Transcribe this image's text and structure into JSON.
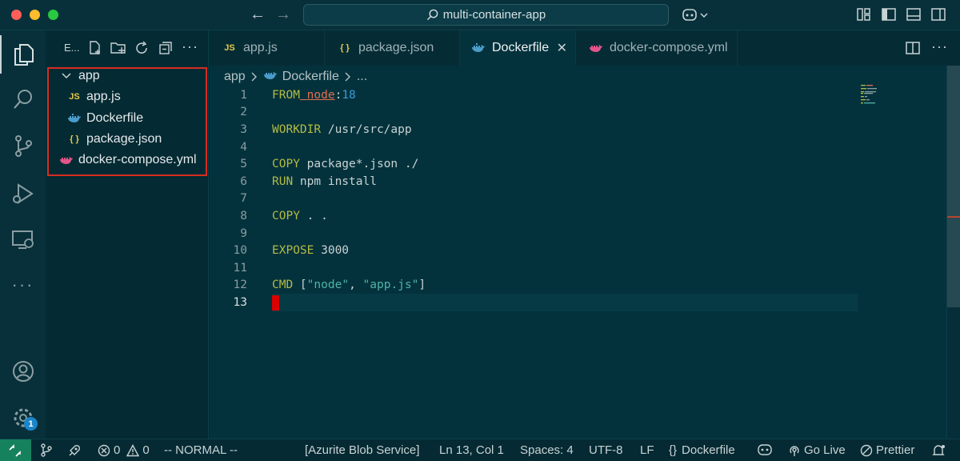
{
  "window": {
    "title": "multi-container-app"
  },
  "sidebar": {
    "title": "E...",
    "tree": [
      {
        "label": "app",
        "type": "folder"
      },
      {
        "label": "app.js",
        "type": "js",
        "icon_text": "JS"
      },
      {
        "label": "Dockerfile",
        "type": "docker"
      },
      {
        "label": "package.json",
        "type": "json",
        "icon_text": "{ }"
      },
      {
        "label": "docker-compose.yml",
        "type": "compose"
      }
    ]
  },
  "tabs": [
    {
      "label": "app.js",
      "icon_text": "JS"
    },
    {
      "label": "package.json",
      "icon_text": "{ }"
    },
    {
      "label": "Dockerfile",
      "active": true
    },
    {
      "label": "docker-compose.yml"
    }
  ],
  "breadcrumb": {
    "folder": "app",
    "file": "Dockerfile",
    "more": "..."
  },
  "editor": {
    "lines": [
      {
        "n": "1",
        "tokens": [
          [
            "kw",
            "FROM"
          ],
          [
            "",
            ""
          ],
          [
            "img",
            "node"
          ],
          [
            "",
            ":"
          ],
          [
            "num",
            "18"
          ]
        ]
      },
      {
        "n": "2",
        "tokens": []
      },
      {
        "n": "3",
        "tokens": [
          [
            "kw",
            "WORKDIR"
          ],
          [
            "",
            " /usr/src/app"
          ]
        ]
      },
      {
        "n": "4",
        "tokens": []
      },
      {
        "n": "5",
        "tokens": [
          [
            "kw",
            "COPY"
          ],
          [
            "",
            " package*.json ./"
          ]
        ]
      },
      {
        "n": "6",
        "tokens": [
          [
            "kw",
            "RUN"
          ],
          [
            "",
            " npm install"
          ]
        ]
      },
      {
        "n": "7",
        "tokens": []
      },
      {
        "n": "8",
        "tokens": [
          [
            "kw",
            "COPY"
          ],
          [
            "",
            " . ."
          ]
        ]
      },
      {
        "n": "9",
        "tokens": []
      },
      {
        "n": "10",
        "tokens": [
          [
            "kw",
            "EXPOSE"
          ],
          [
            "",
            " 3000"
          ]
        ]
      },
      {
        "n": "11",
        "tokens": []
      },
      {
        "n": "12",
        "tokens": [
          [
            "kw",
            "CMD"
          ],
          [
            "",
            " ["
          ],
          [
            "str",
            "\"node\""
          ],
          [
            "",
            ", "
          ],
          [
            "str",
            "\"app.js\""
          ],
          [
            "",
            "]"
          ]
        ]
      },
      {
        "n": "13",
        "tokens": []
      }
    ]
  },
  "activity": {
    "badge": "1"
  },
  "status": {
    "errors": "0",
    "warnings": "0",
    "mode": "-- NORMAL --",
    "azurite": "[Azurite Blob Service]",
    "position": "Ln 13, Col 1",
    "spaces": "Spaces: 4",
    "encoding": "UTF-8",
    "eol": "LF",
    "language": "Dockerfile",
    "golive": "Go Live",
    "prettier": "Prettier"
  },
  "colors": {
    "keyword": "#b3bb45",
    "string": "#4fb4a8",
    "number": "#3b9bd9",
    "image": "#e26f50",
    "accent_remote": "#16825d",
    "highlight_box": "#d62d20"
  }
}
